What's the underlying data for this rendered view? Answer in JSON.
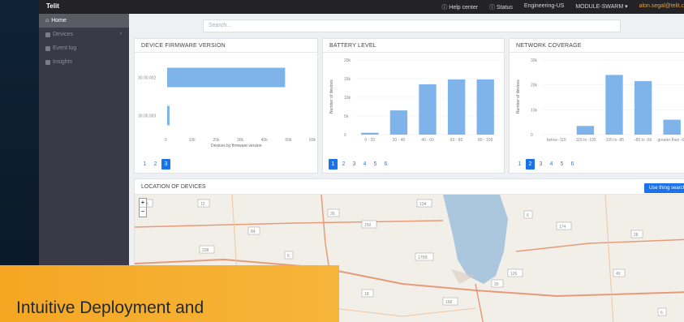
{
  "brand": "Telit",
  "topbar": {
    "help": "Help center",
    "status": "Status",
    "org": "Engineering-US",
    "module": "MODULE-SWARM",
    "user": "alon.segal@telit.c"
  },
  "sidebar": {
    "items": [
      {
        "label": "Home",
        "active": true
      },
      {
        "label": "Devices",
        "active": false
      },
      {
        "label": "Event log",
        "active": false
      },
      {
        "label": "Insights",
        "active": false
      }
    ]
  },
  "search": {
    "placeholder": "Search..."
  },
  "panels": {
    "firmware": {
      "title": "DEVICE FIRMWARE VERSION",
      "xlabel": "Devices by firmware version",
      "pages": [
        "1",
        "2",
        "3"
      ],
      "active_page": "3"
    },
    "battery": {
      "title": "BATTERY LEVEL",
      "ylabel": "Number of devices",
      "pages": [
        "1",
        "2",
        "3",
        "4",
        "5",
        "6"
      ],
      "active_page": "1"
    },
    "network": {
      "title": "NETWORK COVERAGE",
      "ylabel": "Number of devices",
      "pages": [
        "1",
        "2",
        "3",
        "4",
        "5",
        "6"
      ],
      "active_page": "2"
    }
  },
  "map": {
    "title": "LOCATION OF DEVICES",
    "thing_search_label": "Use thing search",
    "zoom_in": "+",
    "zoom_out": "−",
    "road_labels": [
      "78",
      "12",
      "26",
      "134",
      "6",
      "84",
      "150",
      "174",
      "28",
      "238",
      "6",
      "175B",
      "30",
      "126",
      "40",
      "18",
      "168",
      "6"
    ],
    "colors": {
      "land": "#f2efe9",
      "water": "#aac7dd",
      "road": "#e59b7a"
    }
  },
  "overlay": {
    "text": "Intuitive Deployment and"
  },
  "colors": {
    "bar": "#7fb4ea",
    "accent": "#1a73e8",
    "overlay": "#f5a623"
  },
  "chart_data": [
    {
      "type": "bar",
      "orientation": "horizontal",
      "categories": [
        "30.00.002",
        "30.00.003"
      ],
      "values": [
        49000,
        1000
      ],
      "xlim": [
        0,
        60000
      ],
      "xticks": [
        "0",
        "10k",
        "20k",
        "30k",
        "40k",
        "50k",
        "60k"
      ],
      "xlabel": "Devices by firmware version"
    },
    {
      "type": "bar",
      "categories": [
        "0 - 20",
        "20 - 40",
        "40 - 60",
        "60 - 80",
        "80 - 100"
      ],
      "values": [
        500,
        6500,
        13500,
        14800,
        14800
      ],
      "ylim": [
        0,
        20000
      ],
      "yticks": [
        "0",
        "5k",
        "10k",
        "15k",
        "20k"
      ],
      "ylabel": "Number of devices"
    },
    {
      "type": "bar",
      "categories": [
        "below -115",
        "-115 to -105",
        "-105 to -85",
        "-85 to -60",
        "greater than -60"
      ],
      "values": [
        0,
        3500,
        24000,
        21500,
        6000
      ],
      "ylim": [
        0,
        30000
      ],
      "yticks": [
        "0",
        "10k",
        "20k",
        "30k"
      ],
      "ylabel": "Number of devices"
    }
  ]
}
